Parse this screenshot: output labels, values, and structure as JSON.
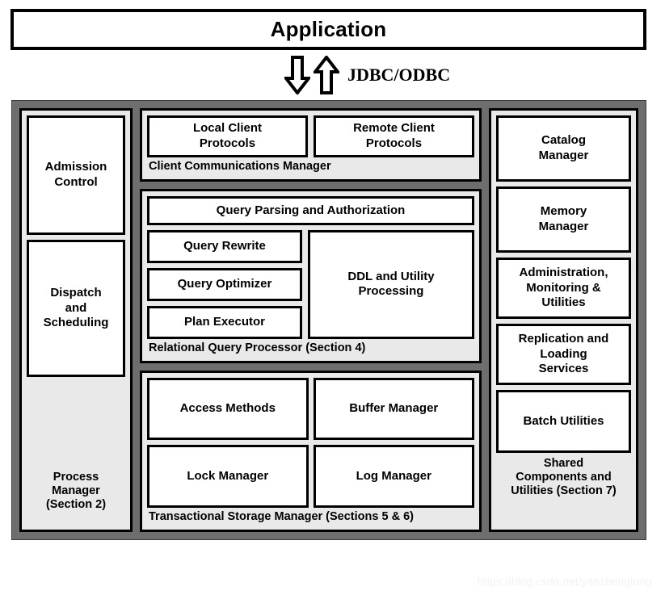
{
  "application": {
    "title": "Application"
  },
  "connector": {
    "label": "JDBC/ODBC",
    "down_arrow_icon": "arrow-down-icon",
    "up_arrow_icon": "arrow-up-icon"
  },
  "process_manager": {
    "label": "Process\nManager\n(Section 2)",
    "label_lines": [
      "Process",
      "Manager",
      "(Section 2)"
    ],
    "boxes": [
      {
        "label": "Admission\nControl",
        "lines": [
          "Admission",
          "Control"
        ]
      },
      {
        "label": "Dispatch\nand\nScheduling",
        "lines": [
          "Dispatch",
          "and",
          "Scheduling"
        ]
      }
    ]
  },
  "client_communications": {
    "label": "Client Communications Manager",
    "boxes": [
      {
        "label": "Local Client\nProtocols",
        "lines": [
          "Local Client",
          "Protocols"
        ]
      },
      {
        "label": "Remote Client\nProtocols",
        "lines": [
          "Remote Client",
          "Protocols"
        ]
      }
    ]
  },
  "query_processor": {
    "label": "Relational Query Processor (Section 4)",
    "top_box": {
      "label": "Query Parsing and Authorization"
    },
    "left_boxes": [
      {
        "label": "Query Rewrite"
      },
      {
        "label": "Query Optimizer"
      },
      {
        "label": "Plan Executor"
      }
    ],
    "right_box": {
      "label": "DDL and Utility\nProcessing",
      "lines": [
        "DDL and Utility",
        "Processing"
      ]
    }
  },
  "storage_manager": {
    "label": "Transactional Storage Manager (Sections 5 & 6)",
    "boxes": [
      {
        "label": "Access Methods"
      },
      {
        "label": "Buffer Manager"
      },
      {
        "label": "Lock Manager"
      },
      {
        "label": "Log Manager"
      }
    ]
  },
  "shared_components": {
    "label": "Shared\nComponents and\nUtilities (Section 7)",
    "label_lines": [
      "Shared",
      "Components and",
      "Utilities (Section 7)"
    ],
    "boxes": [
      {
        "label": "Catalog\nManager",
        "lines": [
          "Catalog",
          "Manager"
        ]
      },
      {
        "label": "Memory\nManager",
        "lines": [
          "Memory",
          "Manager"
        ]
      },
      {
        "label": "Administration,\nMonitoring &\nUtilities",
        "lines": [
          "Administration,",
          "Monitoring &",
          "Utilities"
        ]
      },
      {
        "label": "Replication and\nLoading\nServices",
        "lines": [
          "Replication and",
          "Loading",
          "Services"
        ]
      },
      {
        "label": "Batch Utilities",
        "lines": [
          "Batch Utilities"
        ]
      }
    ]
  },
  "watermark": {
    "text": "https://blog.csdn.net/yanzhengtong"
  },
  "colors": {
    "container_gray": "#6e6e6e",
    "panel_gray": "#e9e9e9",
    "box_white": "#ffffff",
    "outline_black": "#000000",
    "watermark": "#f2f2f2"
  }
}
